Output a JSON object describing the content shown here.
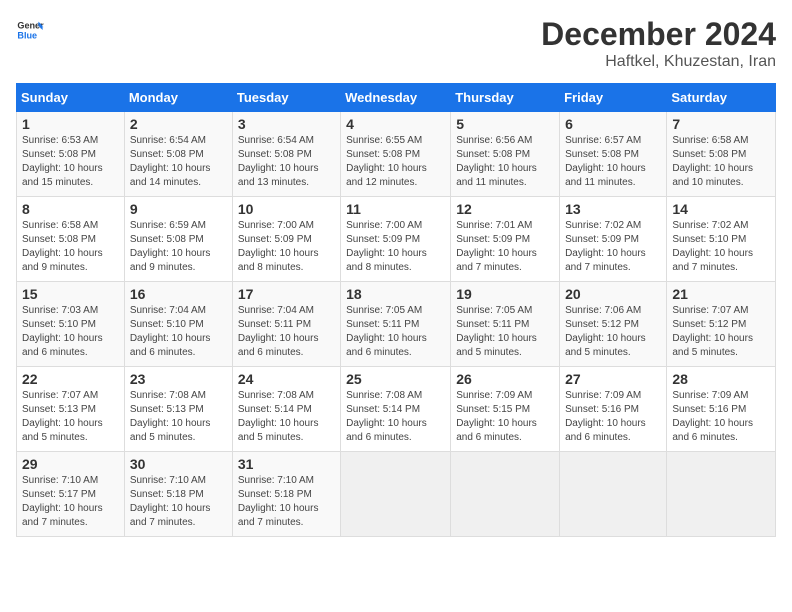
{
  "logo": {
    "text_general": "General",
    "text_blue": "Blue"
  },
  "title": {
    "month": "December 2024",
    "location": "Haftkel, Khuzestan, Iran"
  },
  "days_of_week": [
    "Sunday",
    "Monday",
    "Tuesday",
    "Wednesday",
    "Thursday",
    "Friday",
    "Saturday"
  ],
  "weeks": [
    [
      {
        "day": "1",
        "info": "Sunrise: 6:53 AM\nSunset: 5:08 PM\nDaylight: 10 hours and 15 minutes."
      },
      {
        "day": "2",
        "info": "Sunrise: 6:54 AM\nSunset: 5:08 PM\nDaylight: 10 hours and 14 minutes."
      },
      {
        "day": "3",
        "info": "Sunrise: 6:54 AM\nSunset: 5:08 PM\nDaylight: 10 hours and 13 minutes."
      },
      {
        "day": "4",
        "info": "Sunrise: 6:55 AM\nSunset: 5:08 PM\nDaylight: 10 hours and 12 minutes."
      },
      {
        "day": "5",
        "info": "Sunrise: 6:56 AM\nSunset: 5:08 PM\nDaylight: 10 hours and 11 minutes."
      },
      {
        "day": "6",
        "info": "Sunrise: 6:57 AM\nSunset: 5:08 PM\nDaylight: 10 hours and 11 minutes."
      },
      {
        "day": "7",
        "info": "Sunrise: 6:58 AM\nSunset: 5:08 PM\nDaylight: 10 hours and 10 minutes."
      }
    ],
    [
      {
        "day": "8",
        "info": "Sunrise: 6:58 AM\nSunset: 5:08 PM\nDaylight: 10 hours and 9 minutes."
      },
      {
        "day": "9",
        "info": "Sunrise: 6:59 AM\nSunset: 5:08 PM\nDaylight: 10 hours and 9 minutes."
      },
      {
        "day": "10",
        "info": "Sunrise: 7:00 AM\nSunset: 5:09 PM\nDaylight: 10 hours and 8 minutes."
      },
      {
        "day": "11",
        "info": "Sunrise: 7:00 AM\nSunset: 5:09 PM\nDaylight: 10 hours and 8 minutes."
      },
      {
        "day": "12",
        "info": "Sunrise: 7:01 AM\nSunset: 5:09 PM\nDaylight: 10 hours and 7 minutes."
      },
      {
        "day": "13",
        "info": "Sunrise: 7:02 AM\nSunset: 5:09 PM\nDaylight: 10 hours and 7 minutes."
      },
      {
        "day": "14",
        "info": "Sunrise: 7:02 AM\nSunset: 5:10 PM\nDaylight: 10 hours and 7 minutes."
      }
    ],
    [
      {
        "day": "15",
        "info": "Sunrise: 7:03 AM\nSunset: 5:10 PM\nDaylight: 10 hours and 6 minutes."
      },
      {
        "day": "16",
        "info": "Sunrise: 7:04 AM\nSunset: 5:10 PM\nDaylight: 10 hours and 6 minutes."
      },
      {
        "day": "17",
        "info": "Sunrise: 7:04 AM\nSunset: 5:11 PM\nDaylight: 10 hours and 6 minutes."
      },
      {
        "day": "18",
        "info": "Sunrise: 7:05 AM\nSunset: 5:11 PM\nDaylight: 10 hours and 6 minutes."
      },
      {
        "day": "19",
        "info": "Sunrise: 7:05 AM\nSunset: 5:11 PM\nDaylight: 10 hours and 5 minutes."
      },
      {
        "day": "20",
        "info": "Sunrise: 7:06 AM\nSunset: 5:12 PM\nDaylight: 10 hours and 5 minutes."
      },
      {
        "day": "21",
        "info": "Sunrise: 7:07 AM\nSunset: 5:12 PM\nDaylight: 10 hours and 5 minutes."
      }
    ],
    [
      {
        "day": "22",
        "info": "Sunrise: 7:07 AM\nSunset: 5:13 PM\nDaylight: 10 hours and 5 minutes."
      },
      {
        "day": "23",
        "info": "Sunrise: 7:08 AM\nSunset: 5:13 PM\nDaylight: 10 hours and 5 minutes."
      },
      {
        "day": "24",
        "info": "Sunrise: 7:08 AM\nSunset: 5:14 PM\nDaylight: 10 hours and 5 minutes."
      },
      {
        "day": "25",
        "info": "Sunrise: 7:08 AM\nSunset: 5:14 PM\nDaylight: 10 hours and 6 minutes."
      },
      {
        "day": "26",
        "info": "Sunrise: 7:09 AM\nSunset: 5:15 PM\nDaylight: 10 hours and 6 minutes."
      },
      {
        "day": "27",
        "info": "Sunrise: 7:09 AM\nSunset: 5:16 PM\nDaylight: 10 hours and 6 minutes."
      },
      {
        "day": "28",
        "info": "Sunrise: 7:09 AM\nSunset: 5:16 PM\nDaylight: 10 hours and 6 minutes."
      }
    ],
    [
      {
        "day": "29",
        "info": "Sunrise: 7:10 AM\nSunset: 5:17 PM\nDaylight: 10 hours and 7 minutes."
      },
      {
        "day": "30",
        "info": "Sunrise: 7:10 AM\nSunset: 5:18 PM\nDaylight: 10 hours and 7 minutes."
      },
      {
        "day": "31",
        "info": "Sunrise: 7:10 AM\nSunset: 5:18 PM\nDaylight: 10 hours and 7 minutes."
      },
      null,
      null,
      null,
      null
    ]
  ]
}
